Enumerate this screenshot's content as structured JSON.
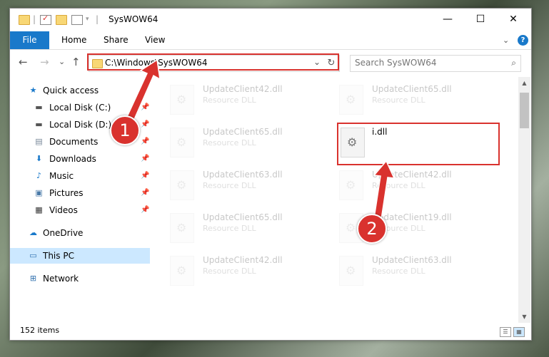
{
  "window": {
    "title": "SysWOW64",
    "minimize_label": "—",
    "maximize_label": "☐",
    "close_label": "✕"
  },
  "ribbon": {
    "file": "File",
    "home": "Home",
    "share": "Share",
    "view": "View",
    "expand_label": "⌄",
    "help_label": "?"
  },
  "nav": {
    "back": "←",
    "forward": "→",
    "recent": "⌄",
    "up": "↑",
    "address": "C:\\Windows\\SysWOW64",
    "address_chevron": "⌄",
    "refresh": "↻",
    "search_placeholder": "Search SysWOW64",
    "search_icon": "⌕"
  },
  "sidebar": {
    "items": [
      {
        "label": "Quick access",
        "icon": "star-icon",
        "glyph": "★"
      },
      {
        "label": "Local Disk (C:)",
        "icon": "drive-icon",
        "glyph": "▬",
        "pin": "📌"
      },
      {
        "label": "Local Disk (D:)",
        "icon": "drive-icon",
        "glyph": "▬",
        "pin": "📌"
      },
      {
        "label": "Documents",
        "icon": "documents-icon",
        "glyph": "▤",
        "pin": "📌"
      },
      {
        "label": "Downloads",
        "icon": "downloads-icon",
        "glyph": "⬇",
        "pin": "📌"
      },
      {
        "label": "Music",
        "icon": "music-icon",
        "glyph": "♪",
        "pin": "📌"
      },
      {
        "label": "Pictures",
        "icon": "pictures-icon",
        "glyph": "▣",
        "pin": "📌"
      },
      {
        "label": "Videos",
        "icon": "videos-icon",
        "glyph": "▦",
        "pin": "📌"
      },
      {
        "label": "OneDrive",
        "icon": "cloud-icon",
        "glyph": "☁"
      },
      {
        "label": "This PC",
        "icon": "computer-icon",
        "glyph": "▭"
      },
      {
        "label": "Network",
        "icon": "network-icon",
        "glyph": "⊞"
      }
    ]
  },
  "files": [
    {
      "name": "UpdateClient42.dll",
      "type": "Resource DLL"
    },
    {
      "name": "UpdateClient65.dll",
      "type": "Resource DLL"
    },
    {
      "name": "UpdateClient65.dll",
      "type": "Resource DLL"
    },
    {
      "name": "i.dll",
      "type": ""
    },
    {
      "name": "UpdateClient63.dll",
      "type": "Resource DLL"
    },
    {
      "name": "UpdateClient42.dll",
      "type": "Resource DLL"
    },
    {
      "name": "UpdateClient65.dll",
      "type": "Resource DLL"
    },
    {
      "name": "UpdateClient19.dll",
      "type": "Resource DLL"
    },
    {
      "name": "UpdateClient42.dll",
      "type": "Resource DLL"
    },
    {
      "name": "UpdateClient63.dll",
      "type": "Resource DLL"
    }
  ],
  "status": {
    "item_count": "152 items"
  },
  "annotations": {
    "step1": "1",
    "step2": "2",
    "color": "#d9322e"
  }
}
